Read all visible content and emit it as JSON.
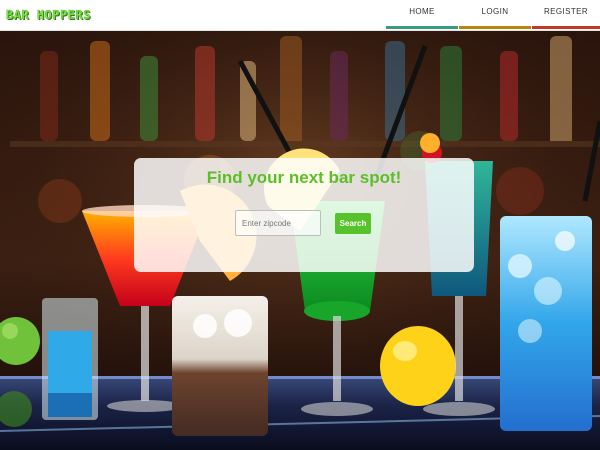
{
  "nav": {
    "brand": "BAR HOPPERS",
    "home": "HOME",
    "login": "LOGIN",
    "register": "REGISTER"
  },
  "search": {
    "title": "Find your next bar spot!",
    "placeholder": "Enter zipcode",
    "button_label": "Search"
  },
  "colors": {
    "brand_green": "#7fe34a",
    "accent_green": "#5cbf2a",
    "home_underline": "#3b9b7e",
    "login_underline": "#b8860b",
    "register_underline": "#c0392b"
  }
}
